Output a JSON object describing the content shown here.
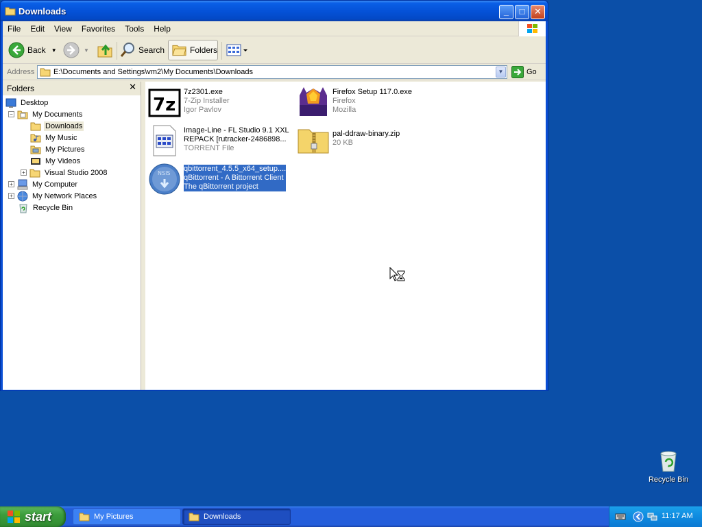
{
  "window": {
    "title": "Downloads",
    "menu": [
      "File",
      "Edit",
      "View",
      "Favorites",
      "Tools",
      "Help"
    ]
  },
  "toolbar": {
    "back_label": "Back",
    "search_label": "Search",
    "folders_label": "Folders"
  },
  "address": {
    "label": "Address",
    "path": "E:\\Documents and Settings\\vm2\\My Documents\\Downloads",
    "go_label": "Go"
  },
  "folders_pane": {
    "title": "Folders",
    "close": "✕",
    "tree": [
      {
        "label": "Desktop"
      },
      {
        "label": "My Documents"
      },
      {
        "label": "Downloads"
      },
      {
        "label": "My Music"
      },
      {
        "label": "My Pictures"
      },
      {
        "label": "My Videos"
      },
      {
        "label": "Visual Studio 2008"
      },
      {
        "label": "My Computer"
      },
      {
        "label": "My Network Places"
      },
      {
        "label": "Recycle Bin"
      }
    ]
  },
  "files": [
    {
      "l1": "7z2301.exe",
      "l2": "7-Zip Installer",
      "l3": "Igor Pavlov"
    },
    {
      "l1": "Firefox Setup 117.0.exe",
      "l2": "Firefox",
      "l3": "Mozilla"
    },
    {
      "l1": "Image-Line - FL Studio 9.1 XXL",
      "l2": "REPACK [rutracker-2486898...",
      "l3": "TORRENT File"
    },
    {
      "l1": "pal-ddraw-binary.zip",
      "l2": "20 KB",
      "l3": ""
    },
    {
      "l1": "qbittorrent_4.5.5_x64_setup....",
      "l2": "qBittorrent - A Bittorrent Client",
      "l3": "The qBittorrent project"
    }
  ],
  "desktop": {
    "recycle_bin_label": "Recycle Bin"
  },
  "taskbar": {
    "start_label": "start",
    "tasks": [
      {
        "label": "My Pictures"
      },
      {
        "label": "Downloads"
      }
    ],
    "clock": "11:17 AM"
  }
}
